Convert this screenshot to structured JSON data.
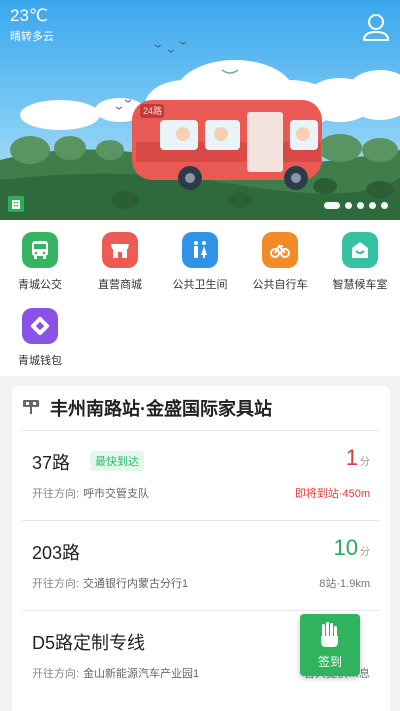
{
  "weather": {
    "temperature": "23℃",
    "description": "晴转多云"
  },
  "banner": {
    "bus_sign": "24路"
  },
  "menu": {
    "items": [
      {
        "label": "青城公交",
        "icon": "bus-icon",
        "color": "#35b562"
      },
      {
        "label": "直营商城",
        "icon": "store-icon",
        "color": "#ee5a55"
      },
      {
        "label": "公共卫生间",
        "icon": "restroom-icon",
        "color": "#2f93e8"
      },
      {
        "label": "公共自行车",
        "icon": "bicycle-icon",
        "color": "#f28a28"
      },
      {
        "label": "智慧候车室",
        "icon": "waiting-room-icon",
        "color": "#34c2a2"
      },
      {
        "label": "青城钱包",
        "icon": "wallet-icon",
        "color": "#8b52e6"
      }
    ]
  },
  "station": {
    "name": "丰州南路站·金盛国际家具站",
    "direction_label": "开往方向:",
    "routes": [
      {
        "name": "37路",
        "tag": "最快到达",
        "destination": "呼市交管支队",
        "eta_value": "1",
        "eta_unit": "分",
        "info": "即将到站·450m"
      },
      {
        "name": "203路",
        "destination": "交通银行内蒙古分行1",
        "eta_value": "10",
        "eta_unit": "分",
        "info": "8站·1.9km"
      },
      {
        "name": "D5路定制专线",
        "destination": "金山新能源汽车产业园1",
        "info": "暂只提供…息"
      }
    ]
  },
  "checkin": {
    "label": "签到"
  },
  "colors": {
    "accent_green": "#2fb35d",
    "alert_red": "#e23c3c"
  }
}
